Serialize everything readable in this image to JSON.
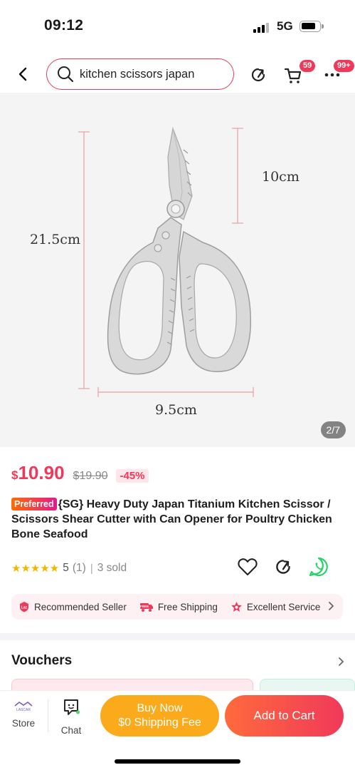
{
  "status_bar": {
    "time": "09:12",
    "network": "5G"
  },
  "header": {
    "search_value": "kitchen scissors japan",
    "cart_badge": "59",
    "more_badge": "99+"
  },
  "product_image": {
    "counter": "2/7",
    "dimensions": {
      "total_length": "21.5cm",
      "blade_length": "10cm",
      "width": "9.5cm"
    }
  },
  "price": {
    "currency": "$",
    "current": "10.90",
    "original": "$19.90",
    "discount": "-45%"
  },
  "product": {
    "badge": "Preferred",
    "title": "{SG} Heavy Duty Japan Titanium Kitchen Scissor / Scissors Shear Cutter with Can Opener for Poultry Chicken Bone Seafood"
  },
  "rating": {
    "score": "5",
    "count": "(1)",
    "separator": "|",
    "sold": "3 sold",
    "stars": 5
  },
  "features": [
    {
      "label": "Recommended Seller",
      "icon": "laz-seller-icon"
    },
    {
      "label": "Free Shipping",
      "icon": "free-truck-icon"
    },
    {
      "label": "Excellent Service",
      "icon": "service-star-icon"
    }
  ],
  "vouchers": {
    "title": "Vouchers"
  },
  "bottom_bar": {
    "store_label": "Store",
    "store_logo_text": "LASCAR",
    "chat_label": "Chat",
    "buy_now_line1": "Buy Now",
    "buy_now_line2": "$0 Shipping Fee",
    "add_to_cart": "Add to Cart"
  },
  "colors": {
    "accent": "#f0395a",
    "buy_now": "#fbaa1c",
    "star": "#f7b500"
  }
}
